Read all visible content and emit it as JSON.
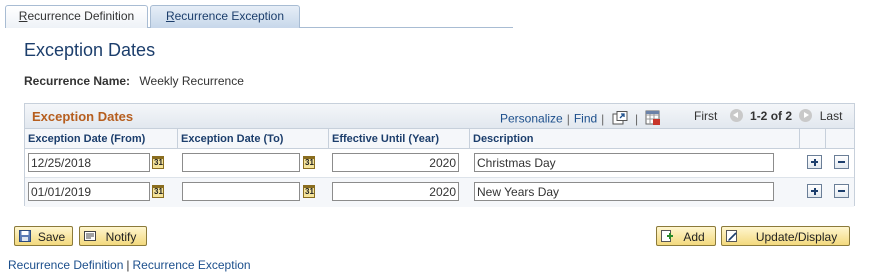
{
  "tabs": [
    {
      "label_first": "R",
      "label_rest": "ecurrence Definition"
    },
    {
      "label_first": "R",
      "label_rest": "ecurrence Exception"
    }
  ],
  "page_title": "Exception Dates",
  "recurrence_name": {
    "label": "Recurrence Name:",
    "value": "Weekly Recurrence"
  },
  "grid": {
    "title": "Exception Dates",
    "personalize": "Personalize",
    "find": "Find",
    "first": "First",
    "count": "1-2 of 2",
    "last": "Last",
    "columns": [
      "Exception Date (From)",
      "Exception Date (To)",
      "Effective Until (Year)",
      "Description"
    ],
    "rows": [
      {
        "from": "12/25/2018",
        "to": "",
        "year": "2020",
        "description": "Christmas Day"
      },
      {
        "from": "01/01/2019",
        "to": "",
        "year": "2020",
        "description": "New Years Day"
      }
    ]
  },
  "buttons": {
    "save": "Save",
    "notify": "Notify",
    "add": "Add",
    "update": "Update/Display"
  },
  "footer": {
    "link1": "Recurrence Definition",
    "sep": "|",
    "link2": "Recurrence Exception"
  }
}
